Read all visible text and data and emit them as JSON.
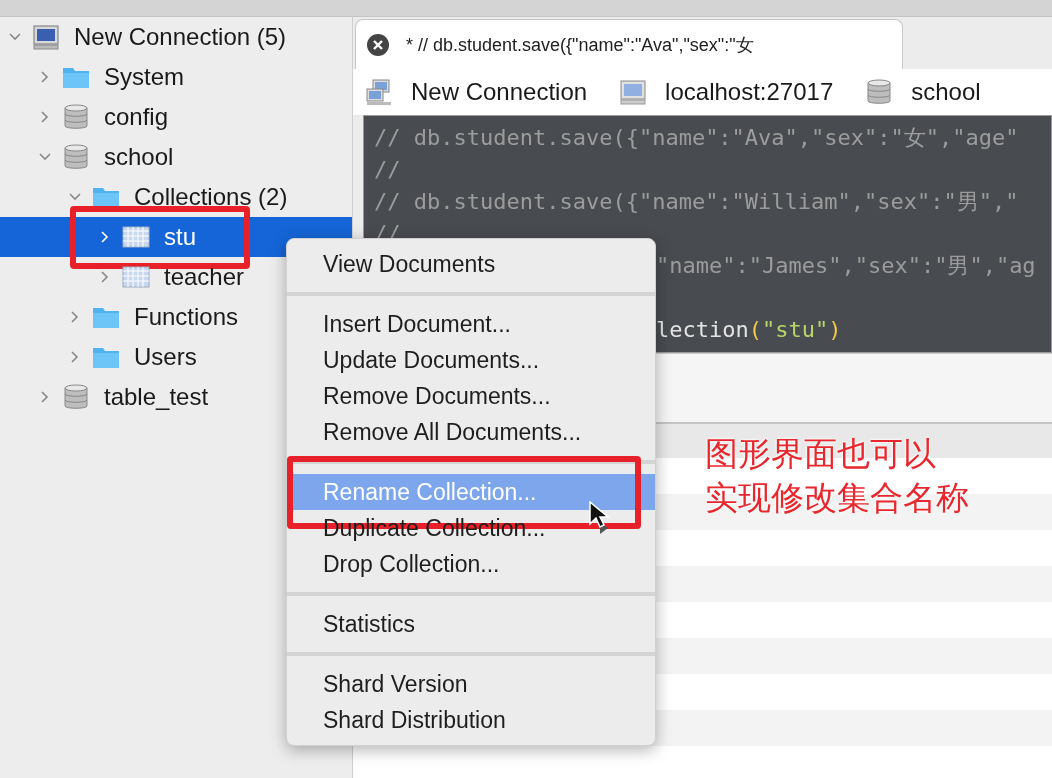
{
  "tree": [
    {
      "label": "New Connection (5)",
      "kind": "connection",
      "expanded": true,
      "selected": false,
      "children": [
        {
          "label": "System",
          "kind": "folder",
          "expanded": false,
          "selected": false
        },
        {
          "label": "config",
          "kind": "database",
          "expanded": false,
          "selected": false
        },
        {
          "label": "school",
          "kind": "database",
          "expanded": true,
          "selected": false,
          "children": [
            {
              "label": "Collections (2)",
              "kind": "folder",
              "expanded": true,
              "selected": false,
              "children": [
                {
                  "label": "stu",
                  "kind": "collection",
                  "expanded": false,
                  "selected": true,
                  "highlighted": true
                },
                {
                  "label": "teacher",
                  "kind": "collection",
                  "expanded": false,
                  "selected": false
                }
              ]
            },
            {
              "label": "Functions",
              "kind": "folder",
              "expanded": false,
              "selected": false
            },
            {
              "label": "Users",
              "kind": "folder",
              "expanded": false,
              "selected": false
            }
          ]
        },
        {
          "label": "table_test",
          "kind": "database",
          "expanded": false,
          "selected": false
        }
      ]
    }
  ],
  "tab": {
    "title": "* // db.student.save({\"name\":\"Ava\",\"sex\":\"女"
  },
  "breadcrumb": [
    {
      "label": "New Connection",
      "kind": "connection"
    },
    {
      "label": "localhost:27017",
      "kind": "server"
    },
    {
      "label": "school",
      "kind": "database"
    }
  ],
  "editor": {
    "lines": [
      {
        "kind": "full",
        "segments": [
          {
            "kind": "comment",
            "text": "// db.student.save({\"name\":\"Ava\",\"sex\":\"女\",\"age\""
          }
        ]
      },
      {
        "kind": "full",
        "segments": [
          {
            "kind": "comment",
            "text": "//"
          }
        ]
      },
      {
        "kind": "full",
        "segments": [
          {
            "kind": "comment",
            "text": "// db.student.save({\"name\":\"William\",\"sex\":\"男\",\""
          }
        ]
      },
      {
        "kind": "full",
        "segments": [
          {
            "kind": "comment",
            "text": "//"
          }
        ]
      },
      {
        "kind": "covered",
        "segments": [
          {
            "kind": "comment",
            "text": "\"name\":\"James\",\"sex\":\"男\",\"ag"
          }
        ]
      },
      {
        "kind": "blank"
      },
      {
        "kind": "covered",
        "segments": [
          {
            "kind": "plain",
            "text": "lection"
          },
          {
            "kind": "paren",
            "text": "("
          },
          {
            "kind": "string",
            "text": "\"stu\""
          },
          {
            "kind": "paren",
            "text": ")"
          }
        ]
      }
    ]
  },
  "context_menu": {
    "groups": [
      [
        {
          "label": "View Documents",
          "selected": false
        }
      ],
      [
        {
          "label": "Insert Document...",
          "selected": false
        },
        {
          "label": "Update Documents...",
          "selected": false
        },
        {
          "label": "Remove Documents...",
          "selected": false
        },
        {
          "label": "Remove All Documents...",
          "selected": false
        }
      ],
      [
        {
          "label": "Rename Collection...",
          "selected": true,
          "highlighted": true
        },
        {
          "label": "Duplicate Collection...",
          "selected": false,
          "submenu": true
        },
        {
          "label": "Drop Collection...",
          "selected": false
        }
      ],
      [
        {
          "label": "Statistics",
          "selected": false
        }
      ],
      [
        {
          "label": "Shard Version",
          "selected": false
        },
        {
          "label": "Shard Distribution",
          "selected": false
        }
      ]
    ]
  },
  "annotation": {
    "lines": [
      "图形界面也可以",
      "实现修改集合名称"
    ]
  }
}
